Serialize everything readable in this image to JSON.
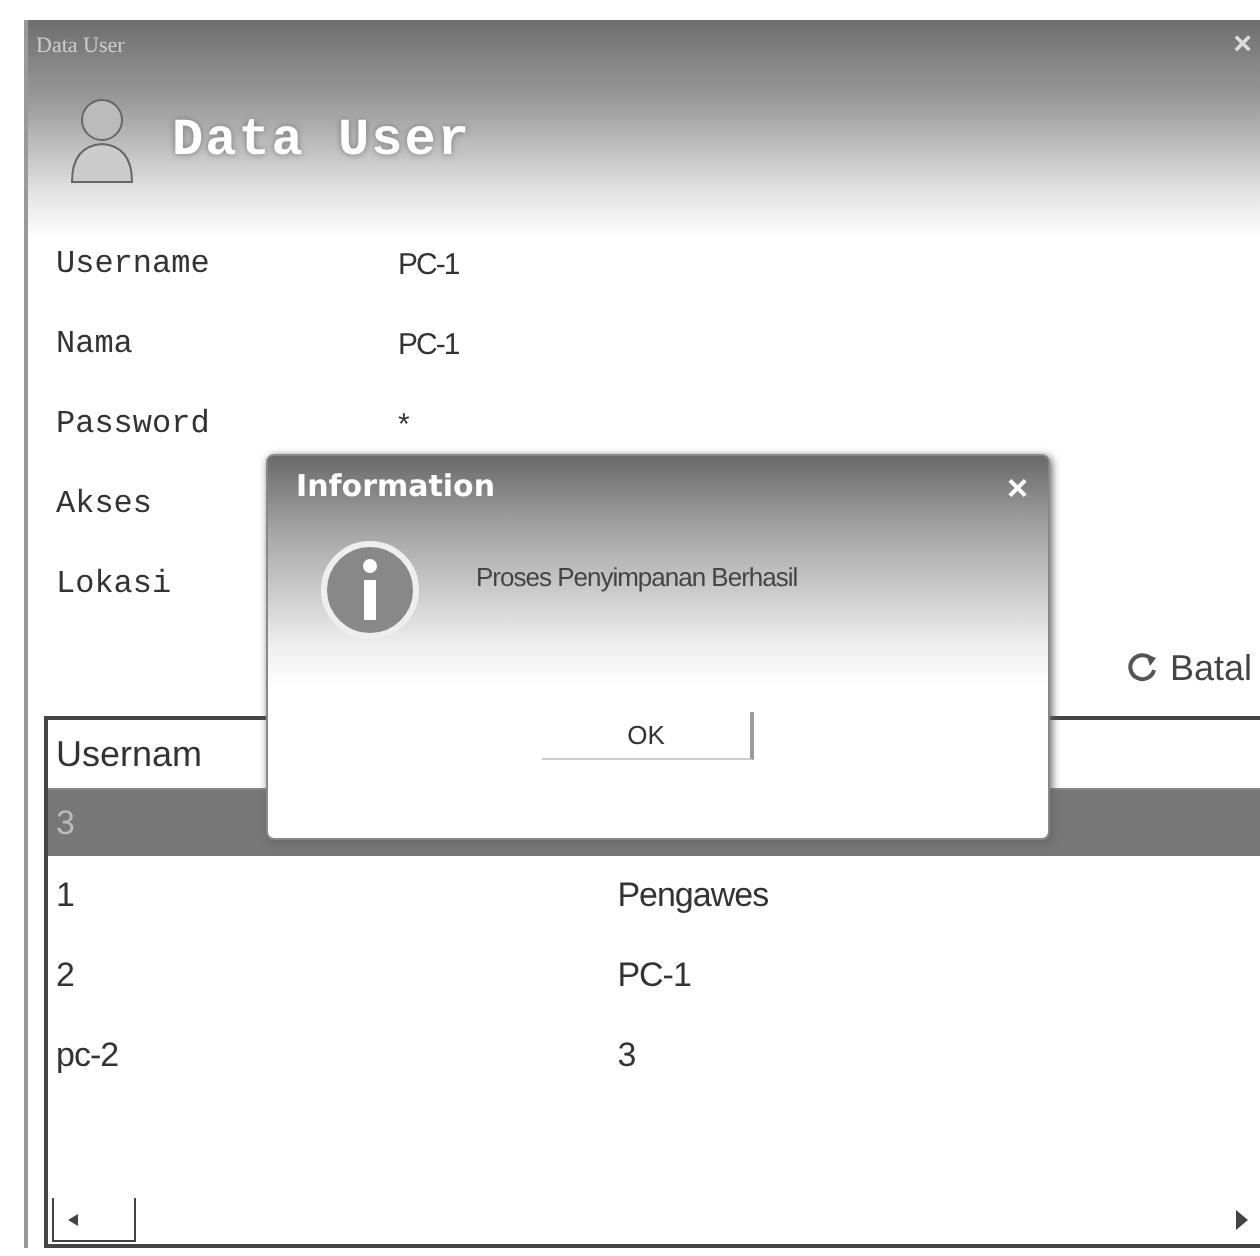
{
  "window": {
    "title": "Data User",
    "close": "×"
  },
  "header": {
    "title": "Data User"
  },
  "form": [
    {
      "label": "Username",
      "value": "PC-1"
    },
    {
      "label": "Nama",
      "value": "PC-1"
    },
    {
      "label": "Password",
      "value": "*"
    },
    {
      "label": "Akses"
    },
    {
      "label": "Lokasi"
    }
  ],
  "cancel_button": {
    "label": "Batal"
  },
  "table": {
    "columns": [
      "Usernam"
    ],
    "rows": [
      {
        "cells": [
          "3",
          ""
        ],
        "selected": true
      },
      {
        "cells": [
          "1",
          "Pengawes"
        ],
        "selected": false
      },
      {
        "cells": [
          "2",
          "PC-1"
        ],
        "selected": false
      },
      {
        "cells": [
          "pc-2",
          "3"
        ],
        "selected": false
      }
    ]
  },
  "dialog": {
    "title": "Information",
    "close": "×",
    "message": "Proses Penyimpanan Berhasil",
    "button": "OK"
  }
}
